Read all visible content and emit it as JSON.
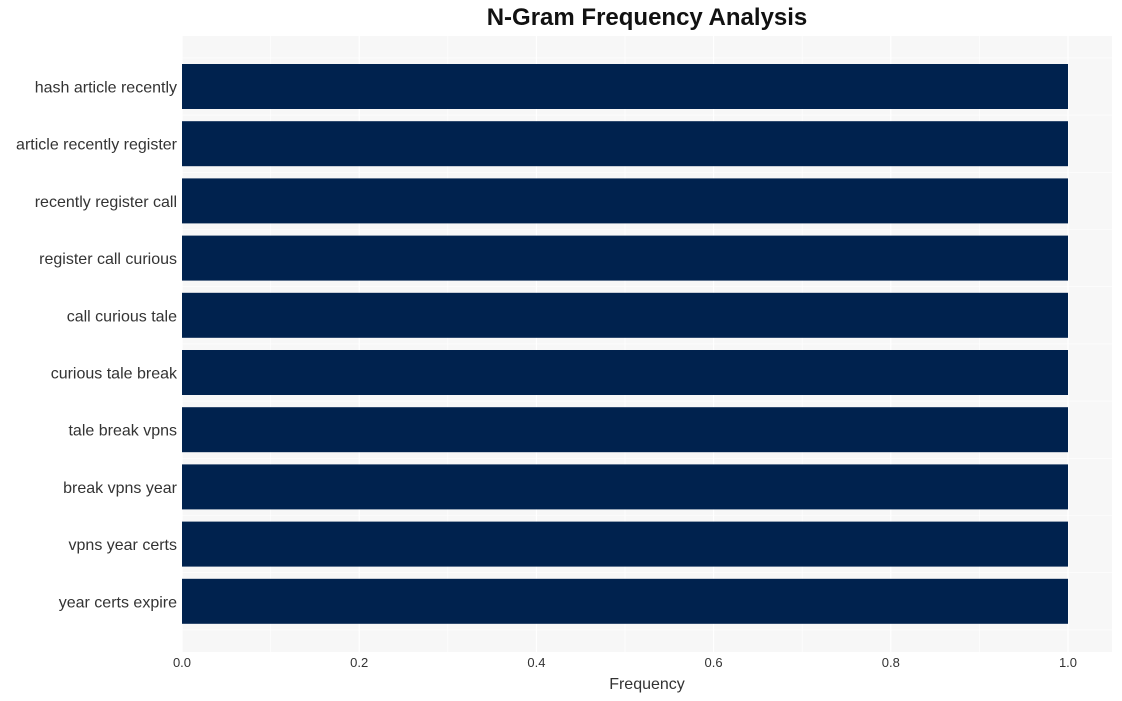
{
  "chart_data": {
    "type": "bar",
    "orientation": "horizontal",
    "title": "N-Gram Frequency Analysis",
    "xlabel": "Frequency",
    "ylabel": "",
    "categories": [
      "hash article recently",
      "article recently register",
      "recently register call",
      "register call curious",
      "call curious tale",
      "curious tale break",
      "tale break vpns",
      "break vpns year",
      "vpns year certs",
      "year certs expire"
    ],
    "values": [
      1,
      1,
      1,
      1,
      1,
      1,
      1,
      1,
      1,
      1
    ],
    "xlim": [
      0,
      1.05
    ],
    "xticks": [
      "0.0",
      "0.2",
      "0.4",
      "0.6",
      "0.8",
      "1.0"
    ],
    "grid": true,
    "legend": "none",
    "colors": {
      "bar": "#00224e",
      "plot_background": "#f7f7f7",
      "grid": "#ffffff"
    }
  }
}
